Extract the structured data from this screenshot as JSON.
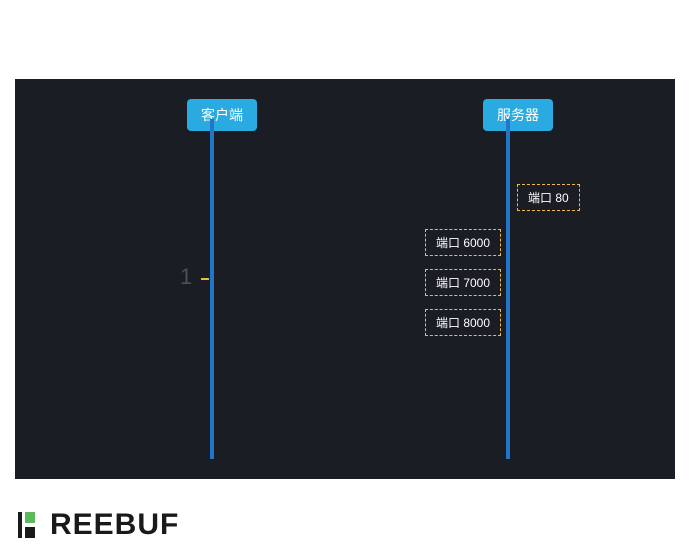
{
  "diagram": {
    "client_label": "客户端",
    "server_label": "服务器",
    "step_number": "1",
    "ports": {
      "p80": "端口 80",
      "p6000": "端口 6000",
      "p7000": "端口 7000",
      "p8000": "端口 8000"
    }
  },
  "watermark": {
    "text": "REEBUF"
  },
  "colors": {
    "canvas_bg": "#1a1e24",
    "node_bg": "#29abe2",
    "lifeline": "#2176c7",
    "port_border": "#f4b942"
  }
}
